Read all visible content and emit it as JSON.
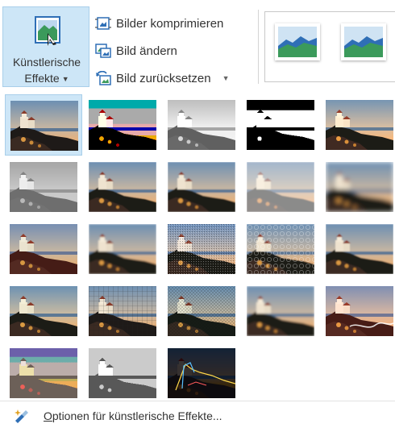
{
  "ribbon": {
    "artistic_effects": {
      "label_line1": "Künstlerische",
      "label_line2": "Effekte"
    },
    "commands": {
      "compress": "Bilder komprimieren",
      "change": "Bild ändern",
      "reset": "Bild zurücksetzen"
    }
  },
  "gallery": {
    "effects": [
      "effect-none",
      "effect-marker",
      "effect-pencil-grayscale",
      "effect-pencil-sketch",
      "effect-line-drawing",
      "effect-chalk-sketch",
      "effect-paint-strokes",
      "effect-paint-brush",
      "effect-glow-diffused",
      "effect-blur",
      "effect-light-screen",
      "effect-watercolor-sponge",
      "effect-film-grain",
      "effect-mosaic-bubbles",
      "effect-glass",
      "effect-cement",
      "effect-texturizer",
      "effect-crisscross-etching",
      "effect-pastels-smooth",
      "effect-plastic-wrap",
      "effect-cutout",
      "effect-photocopy",
      "effect-glow-edges"
    ],
    "selected_index": 0
  },
  "footer": {
    "mnemonic": "O",
    "rest": "ptionen für künstlerische Effekte..."
  },
  "colors": {
    "selection_bg": "#cde6f7",
    "selection_border": "#a9cfea",
    "icon_blue": "#2f6fb6",
    "icon_green": "#3b9a5b"
  }
}
